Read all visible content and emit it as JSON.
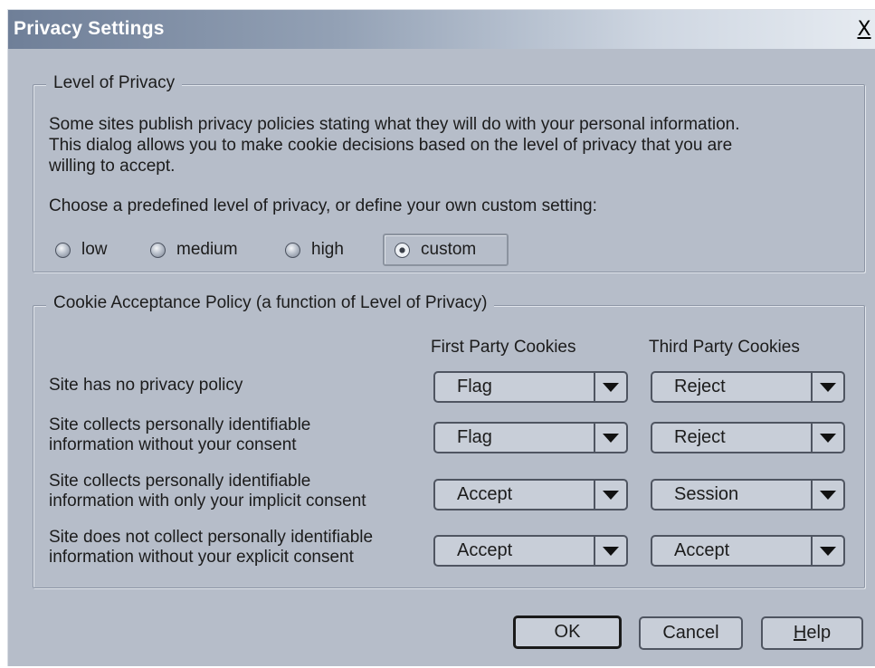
{
  "window": {
    "title": "Privacy Settings",
    "close_label": "X"
  },
  "level_group": {
    "legend": "Level of Privacy",
    "description": [
      "Some sites publish privacy policies stating what they will do with your personal information.",
      "This dialog allows you to make cookie decisions based on the level of privacy that you are",
      "willing to accept."
    ],
    "prompt": "Choose a predefined level of privacy, or define your own custom setting:",
    "options": [
      {
        "label": "low",
        "checked": false
      },
      {
        "label": "medium",
        "checked": false
      },
      {
        "label": "high",
        "checked": false
      },
      {
        "label": "custom",
        "checked": true
      }
    ]
  },
  "policy_group": {
    "legend": "Cookie Acceptance Policy (a function of Level of Privacy)",
    "col_first": "First Party Cookies",
    "col_third": "Third Party Cookies",
    "rows": [
      {
        "label_1": "Site has no privacy policy",
        "label_2": "",
        "first": "Flag",
        "third": "Reject"
      },
      {
        "label_1": "Site collects personally identifiable",
        "label_2": "information without your consent",
        "first": "Flag",
        "third": "Reject"
      },
      {
        "label_1": "Site collects personally identifiable",
        "label_2": "information with only your implicit consent",
        "first": "Accept",
        "third": "Session"
      },
      {
        "label_1": "Site does not collect personally identifiable",
        "label_2": "information without your explicit consent",
        "first": "Accept",
        "third": "Accept"
      }
    ]
  },
  "buttons": {
    "ok": "OK",
    "cancel": "Cancel",
    "help_underlined": "H",
    "help_rest": "elp"
  }
}
